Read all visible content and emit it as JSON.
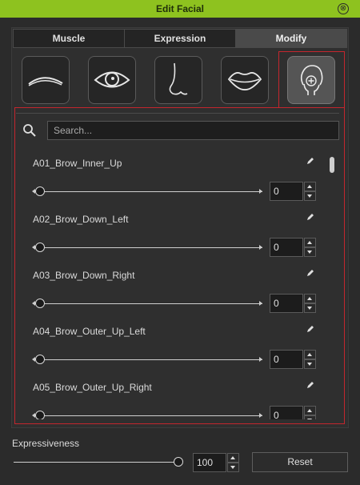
{
  "window": {
    "title": "Edit Facial"
  },
  "tabs": [
    {
      "label": "Muscle"
    },
    {
      "label": "Expression"
    },
    {
      "label": "Modify"
    }
  ],
  "active_tab": "Modify",
  "face_parts": [
    {
      "icon": "eyebrow-icon"
    },
    {
      "icon": "eye-icon"
    },
    {
      "icon": "nose-icon"
    },
    {
      "icon": "lips-icon"
    },
    {
      "icon": "head-add-icon",
      "active": true
    }
  ],
  "search": {
    "placeholder": "Search..."
  },
  "morphs": [
    {
      "label": "A01_Brow_Inner_Up",
      "value": "0"
    },
    {
      "label": "A02_Brow_Down_Left",
      "value": "0"
    },
    {
      "label": "A03_Brow_Down_Right",
      "value": "0"
    },
    {
      "label": "A04_Brow_Outer_Up_Left",
      "value": "0"
    },
    {
      "label": "A05_Brow_Outer_Up_Right",
      "value": "0"
    }
  ],
  "expressiveness": {
    "label": "Expressiveness",
    "value": "100"
  },
  "reset_label": "Reset",
  "colors": {
    "title_bar": "#8ec21f",
    "highlight_border": "#c4262e",
    "background": "#2b2b2b"
  }
}
